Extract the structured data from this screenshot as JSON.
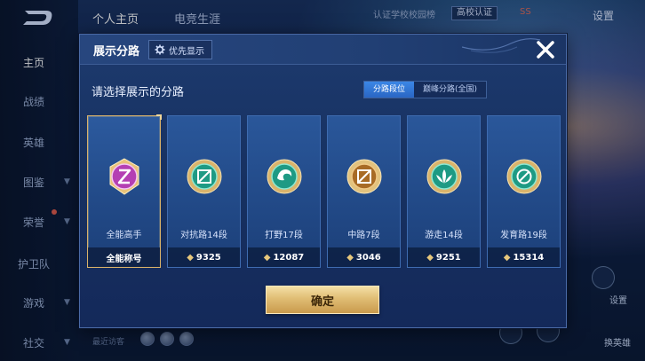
{
  "top_nav": {
    "tabs": [
      {
        "label": "个人主页"
      },
      {
        "label": "电竞生涯"
      }
    ],
    "school_text": "认证学校校园榜",
    "school_badge": "高校认证",
    "coin_text": "SS",
    "settings": "设置"
  },
  "left_nav": {
    "items": [
      {
        "label": "主页"
      },
      {
        "label": "战绩"
      },
      {
        "label": "英雄"
      },
      {
        "label": "图鉴"
      },
      {
        "label": "荣誉"
      },
      {
        "label": "护卫队"
      },
      {
        "label": "游戏"
      },
      {
        "label": "社交"
      }
    ]
  },
  "bottom": {
    "recent_text": "最近访客",
    "right_labels": [
      "设置",
      "换英雄"
    ]
  },
  "modal": {
    "title": "展示分路",
    "priority_label": "优先显示",
    "instruction": "请选择展示的分路",
    "segments": [
      {
        "label": "分路段位",
        "active": true
      },
      {
        "label": "巅峰分路(全国)",
        "active": false
      }
    ],
    "cards": [
      {
        "name": "全能高手",
        "footer": "全能称号",
        "score": null,
        "icon": "all-round-emblem-icon",
        "accent": "#c84fc6",
        "selected": true
      },
      {
        "name": "对抗路14段",
        "footer": null,
        "score": "9325",
        "icon": "clash-lane-emblem-icon",
        "accent": "#1f9b86",
        "selected": false
      },
      {
        "name": "打野17段",
        "footer": null,
        "score": "12087",
        "icon": "jungle-emblem-icon",
        "accent": "#1f9b86",
        "selected": false
      },
      {
        "name": "中路7段",
        "footer": null,
        "score": "3046",
        "icon": "mid-lane-emblem-icon",
        "accent": "#b5762c",
        "selected": false
      },
      {
        "name": "游走14段",
        "footer": null,
        "score": "9251",
        "icon": "roam-emblem-icon",
        "accent": "#1f9b86",
        "selected": false
      },
      {
        "name": "发育路19段",
        "footer": null,
        "score": "15314",
        "icon": "farm-lane-emblem-icon",
        "accent": "#1f9b86",
        "selected": false
      }
    ],
    "confirm_label": "确定"
  },
  "colors": {
    "modal_bg": "#173161",
    "card_bg": "#224a88",
    "gold": "#e0bd74",
    "segment_active": "#2f72d2"
  }
}
